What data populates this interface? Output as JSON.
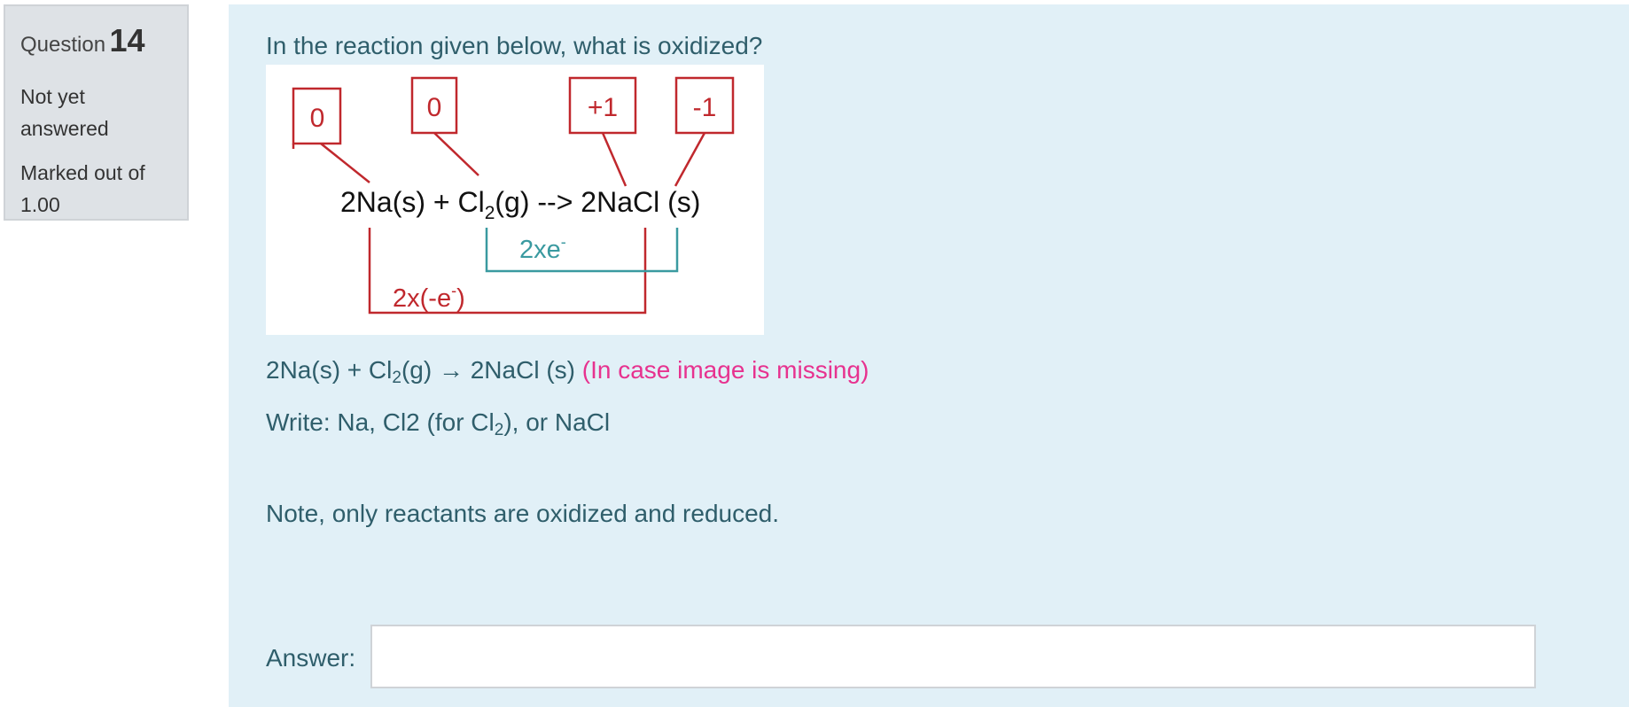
{
  "question_info": {
    "label": "Question",
    "number": "14",
    "status_line1": "Not yet",
    "status_line2": "answered",
    "marks_line1": "Marked out of",
    "marks_line2": "1.00"
  },
  "question_text": {
    "prompt": "In the reaction given below, what is oxidized?",
    "equation_part1": "2Na(s) + Cl",
    "equation_sub": "2",
    "equation_part2": "(g) → 2NaCl (s)",
    "missing_note": "(In case image is missing)",
    "write_part1": "Write: Na, Cl2 (for Cl",
    "write_sub": "2",
    "write_part2": "), or NaCl",
    "note": "Note, only reactants are oxidized and reduced."
  },
  "diagram": {
    "ox_states": [
      "0",
      "0",
      "+1",
      "-1"
    ],
    "equation_part1": "2Na(s) + Cl",
    "equation_sub": "2",
    "equation_part2": "(g) --> 2NaCl (s)",
    "gain_label": "2xe",
    "gain_sup": "-",
    "loss_label": "2x(-e",
    "loss_sup": "-",
    "loss_close": ")",
    "colors": {
      "red": "#c0282d",
      "teal": "#3a9aa0"
    }
  },
  "answer": {
    "label": "Answer:",
    "value": ""
  }
}
